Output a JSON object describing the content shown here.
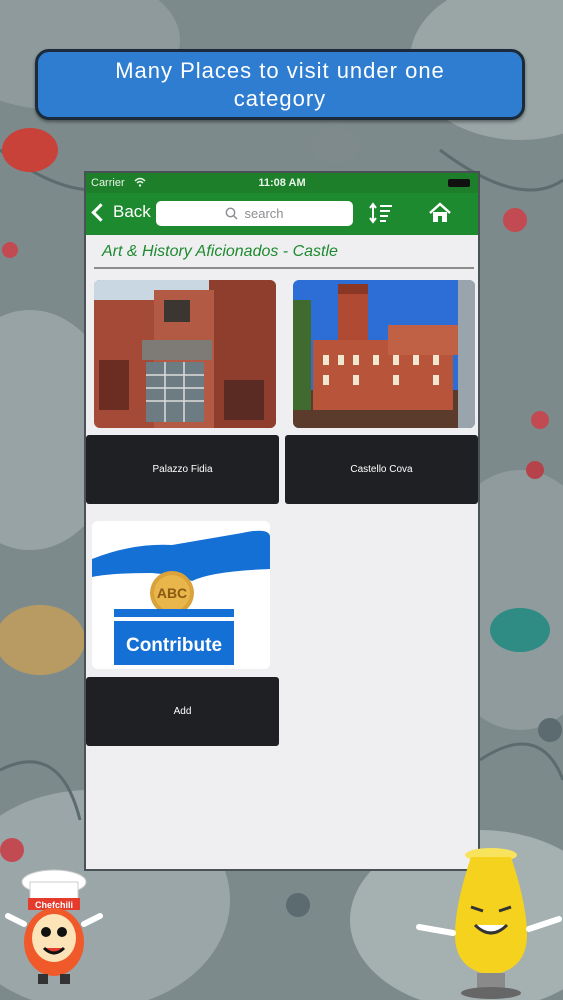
{
  "banner": {
    "text": "Many Places to visit under one category"
  },
  "status_bar": {
    "carrier": "Carrier",
    "time": "11:08 AM"
  },
  "nav": {
    "back_label": "Back",
    "search_placeholder": "search"
  },
  "category_title": "Art & History Aficionados - Castle",
  "places": [
    {
      "name": "Palazzo Fidia"
    },
    {
      "name": "Castello Cova"
    },
    {
      "name": "Add"
    }
  ],
  "contribute_image": {
    "text": "Contribute",
    "coin_letters": "ABC"
  },
  "mascots": {
    "left_logo_text": "Chefchili"
  },
  "colors": {
    "nav_green": "#1e8a2f",
    "banner_blue": "#2f7dd1",
    "card_dark": "#1f2023"
  }
}
